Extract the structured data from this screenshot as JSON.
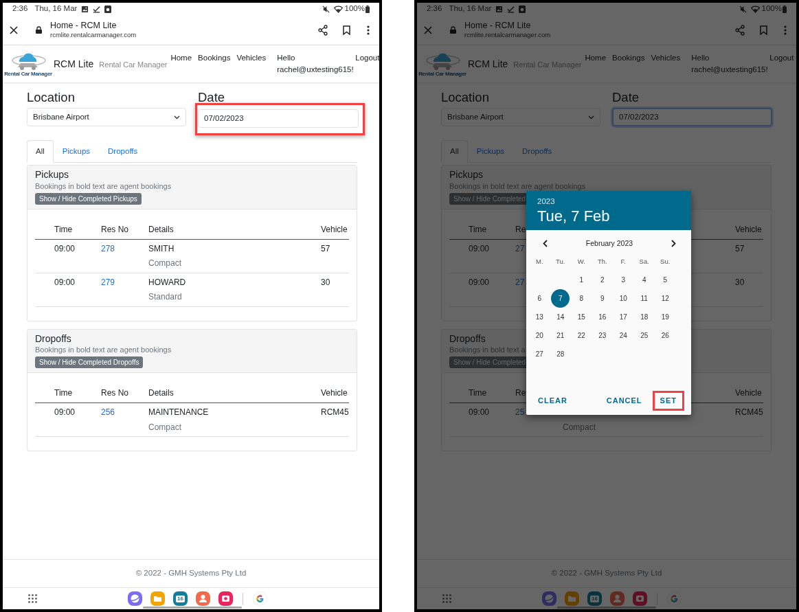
{
  "screens": [
    {
      "dimmed": false,
      "status_bar": {
        "time": "2:36",
        "date": "Thu, 16 Mar",
        "battery": "100%"
      },
      "browser": {
        "title": "Home - RCM Lite",
        "url": "rcmlite.rentalcarmanager.com"
      },
      "navbar": {
        "logo_text": "Rental Car Manager",
        "brand": "RCM Lite",
        "tagline": "Rental Car Manager",
        "links": [
          "Home",
          "Bookings",
          "Vehicles"
        ],
        "greeting": "Hello",
        "user": "rachel@uxtesting615!",
        "logout": "Logout"
      },
      "form": {
        "location_label": "Location",
        "location": "Brisbane Airport",
        "date_label": "Date",
        "date": "07/02/2023",
        "date_focused": false,
        "date_highlighted": true
      },
      "tabs": [
        {
          "label": "All",
          "selected": true
        },
        {
          "label": "Pickups",
          "selected": false
        },
        {
          "label": "Dropoffs",
          "selected": false
        }
      ],
      "sections": [
        {
          "title": "Pickups",
          "note": "Bookings in bold text are agent bookings",
          "button": "Show / Hide Completed Pickups",
          "columns": [
            {
              "kind": "time",
              "label": "Time"
            },
            {
              "kind": "resno",
              "label": "Res No"
            },
            {
              "kind": "details",
              "label": "Details"
            },
            {
              "kind": "vehicle",
              "label": "Vehicle"
            }
          ],
          "rows": [
            {
              "time": "09:00",
              "res_no": "278",
              "details": "SMITH",
              "category": "Compact",
              "vehicle": "57"
            },
            {
              "time": "09:00",
              "res_no": "279",
              "details": "HOWARD",
              "category": "Standard",
              "vehicle": "30"
            }
          ]
        },
        {
          "title": "Dropoffs",
          "note": "Bookings in bold text are agent bookings",
          "button": "Show / Hide Completed Dropoffs",
          "columns": [
            {
              "kind": "time",
              "label": "Time"
            },
            {
              "kind": "resno",
              "label": "Res No"
            },
            {
              "kind": "details",
              "label": "Details"
            },
            {
              "kind": "vehicle",
              "label": "Vehicle"
            }
          ],
          "rows": [
            {
              "time": "09:00",
              "res_no": "256",
              "details": "MAINTENANCE",
              "category": "Compact",
              "vehicle": "RCM45"
            }
          ]
        }
      ],
      "footer": "© 2022 - GMH Systems Pty Ltd",
      "dock": {
        "calendar_day": "16"
      }
    },
    {
      "dimmed": true,
      "status_bar": {
        "time": "2:36",
        "date": "Thu, 16 Mar",
        "battery": "100%"
      },
      "browser": {
        "title": "Home - RCM Lite",
        "url": "rcmlite.rentalcarmanager.com"
      },
      "navbar": {
        "logo_text": "Rental Car Manager",
        "brand": "RCM Lite",
        "tagline": "Rental Car Manager",
        "links": [
          "Home",
          "Bookings",
          "Vehicles"
        ],
        "greeting": "Hello",
        "user": "rachel@uxtesting615!",
        "logout": "Logout"
      },
      "form": {
        "location_label": "Location",
        "location": "Brisbane Airport",
        "date_label": "Date",
        "date": "07/02/2023",
        "date_focused": true,
        "date_highlighted": false
      },
      "tabs": [
        {
          "label": "All",
          "selected": true
        },
        {
          "label": "Pickups",
          "selected": false
        },
        {
          "label": "Dropoffs",
          "selected": false
        }
      ],
      "sections": [
        {
          "title": "Pickups",
          "note": "Bookings in bold text are agent bookings",
          "button": "Show / Hide Completed",
          "columns": [
            {
              "kind": "time",
              "label": "Time"
            },
            {
              "kind": "resno",
              "label": "Re"
            },
            {
              "kind": "vehicle",
              "label": "Vehicle"
            }
          ],
          "rows": [
            {
              "time": "09:00",
              "res_no": "27",
              "vehicle": "57"
            },
            {
              "time": "09:00",
              "res_no": "27",
              "vehicle": "30"
            }
          ]
        },
        {
          "title": "Dropoffs",
          "note": "Bookings in bold text a",
          "button": "Show / Hide Completed",
          "columns": [
            {
              "kind": "time",
              "label": "Time"
            },
            {
              "kind": "resno",
              "label": "Re"
            },
            {
              "kind": "vehicle",
              "label": "Vehicle"
            }
          ],
          "rows": [
            {
              "time": "09:00",
              "res_no": "25",
              "category": "Compact",
              "vehicle": "RCM45"
            }
          ]
        }
      ],
      "footer": "© 2022 - GMH Systems Pty Ltd",
      "dock": {
        "calendar_day": "16"
      },
      "dialog": {
        "year": "2023",
        "date": "Tue, 7 Feb",
        "month": "February 2023",
        "weekdays": [
          "M.",
          "Tu.",
          "W.",
          "Th.",
          "F.",
          "Sa.",
          "Su."
        ],
        "weeks": [
          [
            {
              "day": "1",
              "selected": false
            },
            {
              "day": "2",
              "selected": false
            },
            {
              "day": "3",
              "selected": false
            },
            {
              "day": "4",
              "selected": false
            },
            {
              "day": "5",
              "selected": false
            }
          ],
          [
            {
              "day": "6",
              "selected": false
            },
            {
              "day": "7",
              "selected": true
            },
            {
              "day": "8",
              "selected": false
            },
            {
              "day": "9",
              "selected": false
            },
            {
              "day": "10",
              "selected": false
            },
            {
              "day": "11",
              "selected": false
            },
            {
              "day": "12",
              "selected": false
            }
          ],
          [
            {
              "day": "13",
              "selected": false
            },
            {
              "day": "14",
              "selected": false
            },
            {
              "day": "15",
              "selected": false
            },
            {
              "day": "16",
              "selected": false
            },
            {
              "day": "17",
              "selected": false
            },
            {
              "day": "18",
              "selected": false
            },
            {
              "day": "19",
              "selected": false
            }
          ],
          [
            {
              "day": "20",
              "selected": false
            },
            {
              "day": "21",
              "selected": false
            },
            {
              "day": "22",
              "selected": false
            },
            {
              "day": "23",
              "selected": false
            },
            {
              "day": "24",
              "selected": false
            },
            {
              "day": "25",
              "selected": false
            },
            {
              "day": "26",
              "selected": false
            }
          ],
          [
            {
              "day": "27",
              "selected": false
            },
            {
              "day": "28",
              "selected": false
            }
          ]
        ],
        "actions": [
          {
            "label": "CLEAR",
            "highlighted": false
          },
          {
            "label": "CANCEL",
            "highlighted": false
          },
          {
            "label": "SET",
            "highlighted": true
          }
        ]
      }
    }
  ]
}
